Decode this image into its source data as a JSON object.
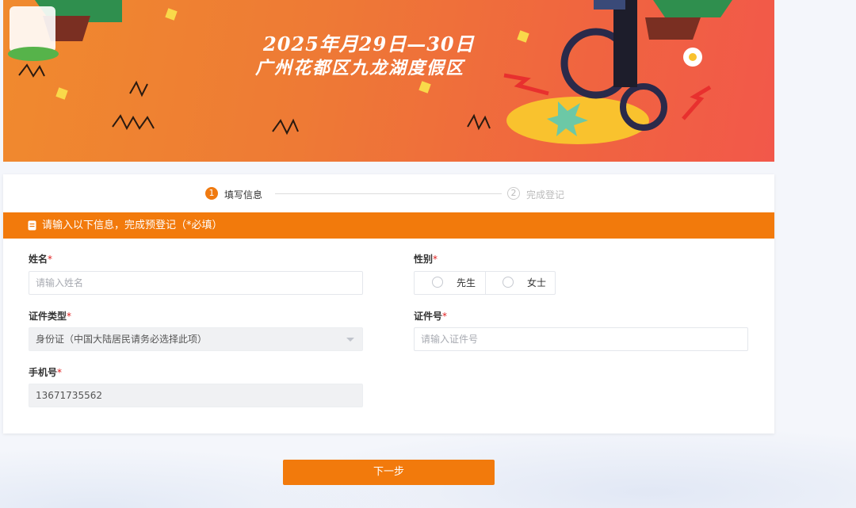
{
  "banner": {
    "date_line": "2025年月29日—30日",
    "location_line": "广州花都区九龙湖度假区"
  },
  "steps": [
    {
      "number": "1",
      "label": "填写信息"
    },
    {
      "number": "2",
      "label": "完成登记"
    }
  ],
  "notice": {
    "icon": "document-icon",
    "text": "请输入以下信息，完成预登记（*必填）"
  },
  "form": {
    "name": {
      "label": "姓名",
      "required": "*",
      "placeholder": "请输入姓名",
      "value": ""
    },
    "gender": {
      "label": "性别",
      "required": "*",
      "options": [
        "先生",
        "女士"
      ]
    },
    "id_type": {
      "label": "证件类型",
      "required": "*",
      "value": "身份证（中国大陆居民请务必选择此项）"
    },
    "id_number": {
      "label": "证件号",
      "required": "*",
      "placeholder": "请输入证件号",
      "value": ""
    },
    "phone": {
      "label": "手机号",
      "required": "*",
      "value": "13671735562"
    }
  },
  "next_button": {
    "label": "下一步"
  },
  "colors": {
    "accent": "#f27a0c",
    "required": "#e02020"
  }
}
